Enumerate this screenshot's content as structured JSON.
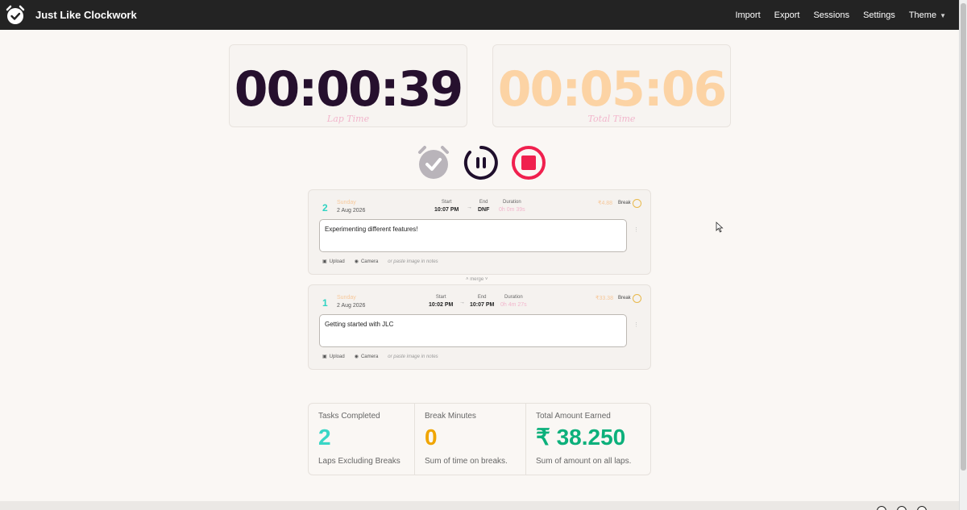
{
  "app": {
    "title": "Just Like Clockwork"
  },
  "nav": {
    "items": [
      "Import",
      "Export",
      "Sessions",
      "Settings"
    ],
    "theme_label": "Theme"
  },
  "timers": {
    "lap": {
      "value": "00:00:39",
      "label": "Lap Time"
    },
    "total": {
      "value": "00:05:06",
      "label": "Total Time"
    }
  },
  "laps": [
    {
      "number": "2",
      "day": "Sunday",
      "date": "2 Aug 2026",
      "start_label": "Start",
      "start": "10:07 PM",
      "end_label": "End",
      "end": "DNF",
      "duration_label": "Duration",
      "duration": "0h 0m 39s",
      "amount": "₹4.88",
      "break_label": "Break",
      "notes": "Experimenting different features!",
      "upload_label": "Upload",
      "camera_label": "Camera",
      "paste_hint": "or paste image in notes"
    },
    {
      "number": "1",
      "day": "Sunday",
      "date": "2 Aug 2026",
      "start_label": "Start",
      "start": "10:02 PM",
      "end_label": "End",
      "end": "10:07 PM",
      "duration_label": "Duration",
      "duration": "0h 4m 27s",
      "amount": "₹33.38",
      "break_label": "Break",
      "notes": "Getting started with JLC",
      "upload_label": "Upload",
      "camera_label": "Camera",
      "paste_hint": "or paste image in notes"
    }
  ],
  "merge_label": "merge",
  "stats": {
    "tasks": {
      "title": "Tasks Completed",
      "value": "2",
      "desc": "Laps Excluding Breaks"
    },
    "break": {
      "title": "Break Minutes",
      "value": "0",
      "desc": "Sum of time on breaks."
    },
    "total": {
      "title": "Total Amount Earned",
      "value": "₹ 38.250",
      "desc": "Sum of amount on all laps."
    }
  },
  "colors": {
    "navbar": "#232323",
    "lap_timer": "#26102e",
    "total_timer": "#fcd3a4",
    "accent_teal": "#3ad6c6",
    "stop": "#f0204e"
  }
}
